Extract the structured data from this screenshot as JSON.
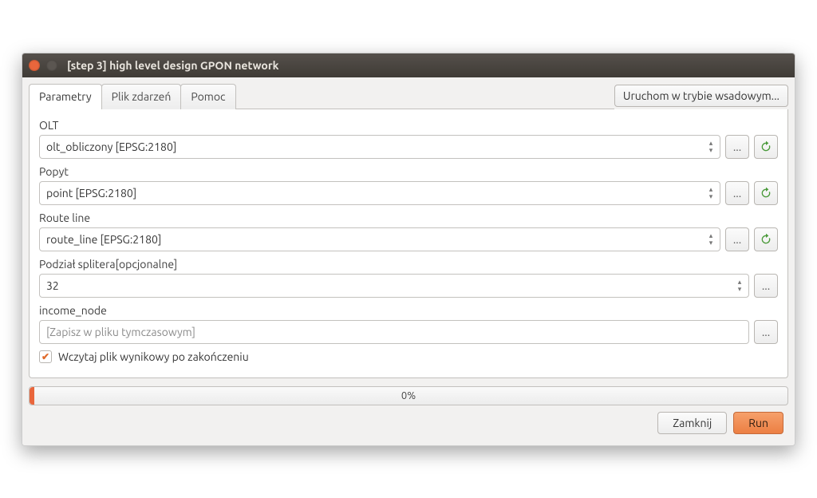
{
  "window": {
    "title": "[step 3] high level design GPON network"
  },
  "tabs": {
    "params": "Parametry",
    "log": "Plik zdarzeń",
    "help": "Pomoc"
  },
  "batch_button": "Uruchom w trybie wsadowym...",
  "fields": {
    "olt": {
      "label": "OLT",
      "value": "olt_obliczony [EPSG:2180]"
    },
    "popyt": {
      "label": "Popyt",
      "value": "point [EPSG:2180]"
    },
    "route": {
      "label": "Route line",
      "value": "route_line [EPSG:2180]"
    },
    "splitter": {
      "label": "Podział splitera[opcjonalne]",
      "value": "32"
    },
    "income": {
      "label": "income_node",
      "placeholder": "[Zapisz w pliku tymczasowym]"
    }
  },
  "checkbox": {
    "label": "Wczytaj plik wynikowy po zakończeniu",
    "checked": true
  },
  "progress": {
    "text": "0%"
  },
  "buttons": {
    "close": "Zamknij",
    "run": "Run"
  },
  "icons": {
    "ellipsis": "...",
    "iterate": "↻"
  }
}
